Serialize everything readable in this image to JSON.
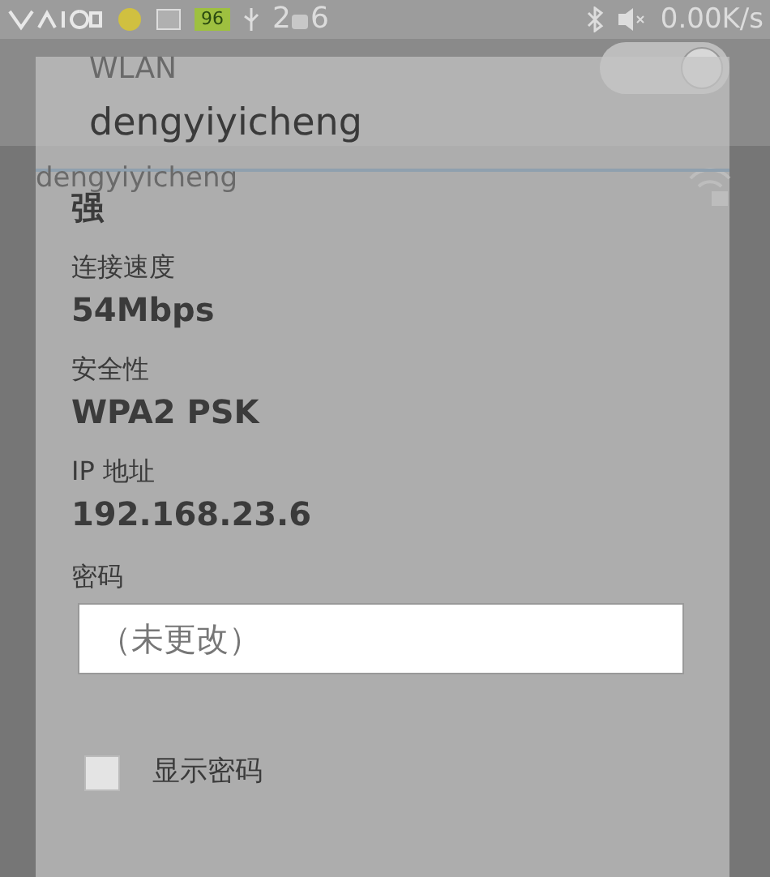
{
  "status_bar": {
    "time_start": "2",
    "time_end": "6",
    "battery": "96",
    "speed": "0.00K/s"
  },
  "background": {
    "title": "WLAN",
    "wlan_switch": {
      "on": true
    },
    "network": {
      "name": "dengyiyicheng"
    }
  },
  "dialog": {
    "title": "dengyiyicheng",
    "signal": "强",
    "fields": [
      {
        "label": "连接速度",
        "value": "54Mbps"
      },
      {
        "label": "安全性",
        "value": "WPA2 PSK"
      },
      {
        "label": "IP 地址",
        "value": "192.168.23.6"
      }
    ],
    "password": {
      "label": "密码",
      "placeholder": "（未更改）"
    },
    "show_password": {
      "label": "显示密码",
      "checked": false
    }
  }
}
